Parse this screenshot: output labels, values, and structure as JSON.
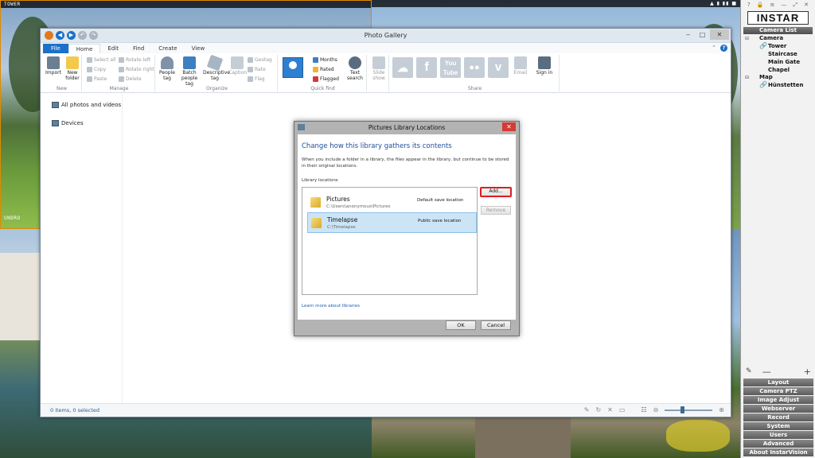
{
  "camera_tiles": {
    "top_left_label": "TOWER",
    "top_left_bottom_label": "UNDRO",
    "top_bar_icons": "▲ ▮ ▮▮ ■"
  },
  "right_panel": {
    "top_icons": [
      "?",
      "🔒",
      "≡",
      "—",
      "⤢",
      "✕"
    ],
    "logo": "INSTAR",
    "list_header": "Camera List",
    "tree": [
      {
        "label": "Camera",
        "toggle": "⊟"
      },
      {
        "label": "Tower",
        "icon": "link"
      },
      {
        "label": "Staircase"
      },
      {
        "label": "Main Gate"
      },
      {
        "label": "Chapel"
      },
      {
        "label": "Map",
        "toggle": "⊟"
      },
      {
        "label": "Hünstetten",
        "icon": "link"
      }
    ],
    "tools": [
      "✎",
      "—",
      "+"
    ],
    "menu": [
      "Layout",
      "Camera PTZ",
      "Image Adjust",
      "Webserver",
      "Record",
      "System",
      "Users",
      "Advanced",
      "About InstarVision"
    ]
  },
  "photo_gallery": {
    "title": "Photo Gallery",
    "tabs": [
      "File",
      "Home",
      "Edit",
      "Find",
      "Create",
      "View"
    ],
    "active_tab": "Home",
    "ribbon": {
      "new": {
        "label": "New",
        "import": "Import",
        "new_folder": "New folder"
      },
      "manage": {
        "label": "Manage",
        "select_all": "Select all",
        "copy": "Copy",
        "paste": "Paste",
        "rotate_left": "Rotate left",
        "rotate_right": "Rotate right",
        "delete": "Delete"
      },
      "organize": {
        "label": "Organize",
        "people_tag": "People tag",
        "batch_people_tag": "Batch people tag",
        "descriptive_tag": "Descriptive tag",
        "caption": "Caption",
        "geotag": "Geotag",
        "rate": "Rate",
        "flag": "Flag"
      },
      "quick_find": {
        "label": "Quick find",
        "months": "Months",
        "rated": "Rated",
        "flagged": "Flagged",
        "text_search": "Text search"
      },
      "slide_show": "Slide show",
      "share": {
        "label": "Share",
        "email": "Email",
        "sign_in": "Sign in"
      }
    },
    "nav": {
      "all_photos": "All photos and videos",
      "devices": "Devices"
    },
    "status": "0 items, 0 selected",
    "zoom_fraction": 0.35
  },
  "dialog": {
    "title": "Pictures Library Locations",
    "heading": "Change how this library gathers its contents",
    "description": "When you include a folder in a library, the files appear in the library, but continue to be stored in their original locations.",
    "locations_label": "Library locations",
    "locations": [
      {
        "name": "Pictures",
        "path": "C:\\Users\\anonymous\\Pictures",
        "status": "Default save location",
        "selected": false
      },
      {
        "name": "Timelapse",
        "path": "C:\\Timelapse",
        "status": "Public save location",
        "selected": true
      }
    ],
    "add_button": "Add...",
    "remove_button": "Remove",
    "learn_more": "Learn more about libraries",
    "ok": "OK",
    "cancel": "Cancel"
  }
}
